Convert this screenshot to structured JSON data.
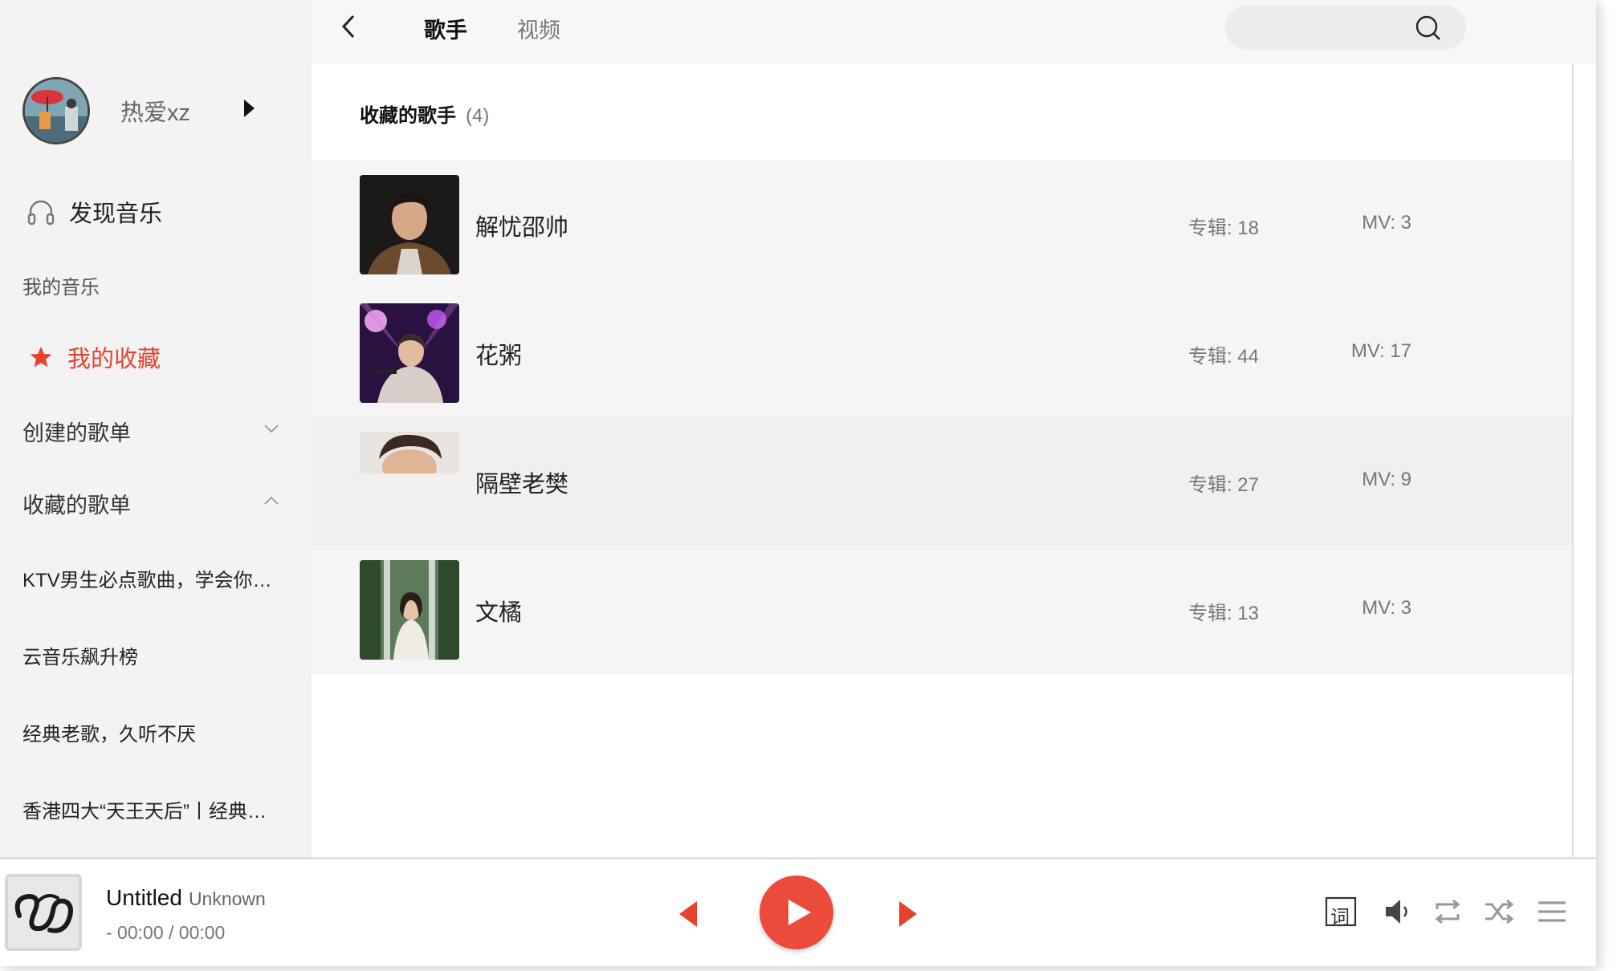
{
  "window": {
    "buttons": [
      "close",
      "minimize",
      "maximize"
    ]
  },
  "sidebar": {
    "user": {
      "name": "热爱xz"
    },
    "discover_label": "发现音乐",
    "my_music_label": "我的音乐",
    "favorites_label": "我的收藏",
    "created_playlists_label": "创建的歌单",
    "collected_playlists_label": "收藏的歌单",
    "playlists": [
      "KTV男生必点歌曲，学会你…",
      "云音乐飙升榜",
      "经典老歌，久听不厌",
      "香港四大“天王天后”丨经典…"
    ]
  },
  "topbar": {
    "tabs": [
      {
        "label": "歌手",
        "active": true
      },
      {
        "label": "视频",
        "active": false
      }
    ],
    "search_placeholder": ""
  },
  "main": {
    "list_title": "收藏的歌手",
    "list_count": "(4)",
    "artists": [
      {
        "name": "解忧邵帅",
        "albums": "专辑: 18",
        "mvs": "MV: 3"
      },
      {
        "name": "花粥",
        "albums": "专辑: 44",
        "mvs": "MV: 17"
      },
      {
        "name": "隔壁老樊",
        "albums": "专辑: 27",
        "mvs": "MV: 9"
      },
      {
        "name": "文橘",
        "albums": "专辑: 13",
        "mvs": "MV: 3"
      }
    ]
  },
  "player": {
    "title": "Untitled",
    "artist": "Unknown",
    "time": "- 00:00 / 00:00",
    "lyrics_label": "词"
  },
  "colors": {
    "accent": "#ec4b3c",
    "sidebar_bg": "#f3f3f3",
    "active_text": "#e8412f"
  }
}
